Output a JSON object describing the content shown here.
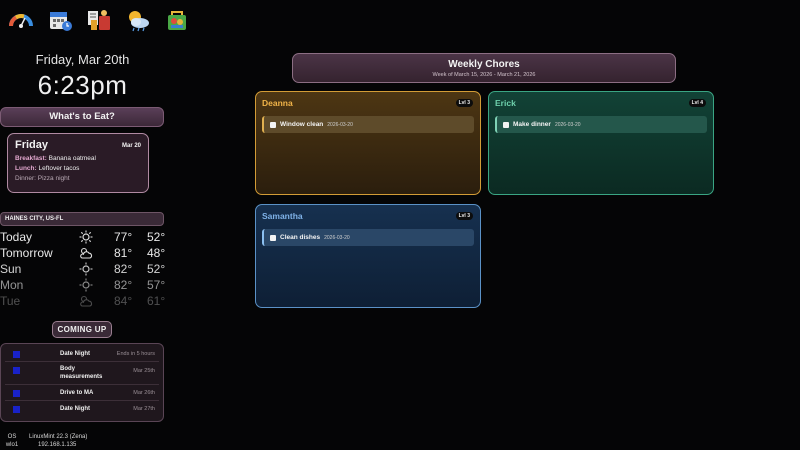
{
  "top_icons": [
    {
      "name": "gauge-icon",
      "colors": [
        "#e35b3a",
        "#f0b730",
        "#3a8ee0"
      ]
    },
    {
      "name": "calendar-icon",
      "colors": [
        "#3b7bd8",
        "#e8e8e8"
      ]
    },
    {
      "name": "chores-icon",
      "colors": [
        "#c83a32",
        "#e2a02b"
      ]
    },
    {
      "name": "weather-icon",
      "colors": [
        "#f1b52e",
        "#bcd6f0"
      ]
    },
    {
      "name": "shopping-icon",
      "colors": [
        "#4aa846",
        "#e7b63a"
      ]
    }
  ],
  "clock": {
    "date": "Friday, Mar 20th",
    "time": "6:23pm"
  },
  "meals": {
    "header": "What's to Eat?",
    "day": "Friday",
    "date": "Mar 20",
    "items": [
      {
        "label": "Breakfast:",
        "value": "Banana oatmeal"
      },
      {
        "label": "Lunch:",
        "value": "Leftover tacos"
      },
      {
        "label": "Dinner:",
        "value": "Pizza night"
      }
    ]
  },
  "weather": {
    "location": "HAINES CITY, US-FL",
    "days": [
      {
        "day": "Today",
        "icon": "sun-icon",
        "hi": "77°",
        "lo": "52°",
        "opacity": 1.0
      },
      {
        "day": "Tomorrow",
        "icon": "partly-cloudy-icon",
        "hi": "81°",
        "lo": "48°",
        "opacity": 1.0
      },
      {
        "day": "Sun",
        "icon": "sun-icon",
        "hi": "82°",
        "lo": "52°",
        "opacity": 0.9
      },
      {
        "day": "Mon",
        "icon": "sun-icon",
        "hi": "82°",
        "lo": "57°",
        "opacity": 0.65
      },
      {
        "day": "Tue",
        "icon": "partly-cloudy-icon",
        "hi": "84°",
        "lo": "61°",
        "opacity": 0.35
      }
    ]
  },
  "coming_up": {
    "header": "COMING UP",
    "events": [
      {
        "title": "Date Night",
        "when": "Ends in 5 hours",
        "color": "#1922c8"
      },
      {
        "title": "Body measurements",
        "when": "Mar 25th",
        "color": "#1922c8"
      },
      {
        "title": "Drive to MA",
        "when": "Mar 26th",
        "color": "#1922c8"
      },
      {
        "title": "Date Night",
        "when": "Mar 27th",
        "color": "#1922c8"
      }
    ]
  },
  "system": [
    {
      "key": "OS",
      "value": "LinuxMint 22.3 (Zena)"
    },
    {
      "key": "wlo1",
      "value": "192.168.1.135"
    }
  ],
  "chores": {
    "title": "Weekly Chores",
    "subtitle": "Week of March 15, 2026 - March 21, 2026",
    "people": [
      {
        "name": "Deanna",
        "level": "Lvl 3",
        "tasks": [
          {
            "name": "Window clean",
            "date": "2026-03-20"
          }
        ]
      },
      {
        "name": "Erick",
        "level": "Lvl 4",
        "tasks": [
          {
            "name": "Make dinner",
            "date": "2026-03-20"
          }
        ]
      },
      {
        "name": "Samantha",
        "level": "Lvl 3",
        "tasks": [
          {
            "name": "Clean dishes",
            "date": "2026-03-20"
          }
        ]
      }
    ]
  }
}
